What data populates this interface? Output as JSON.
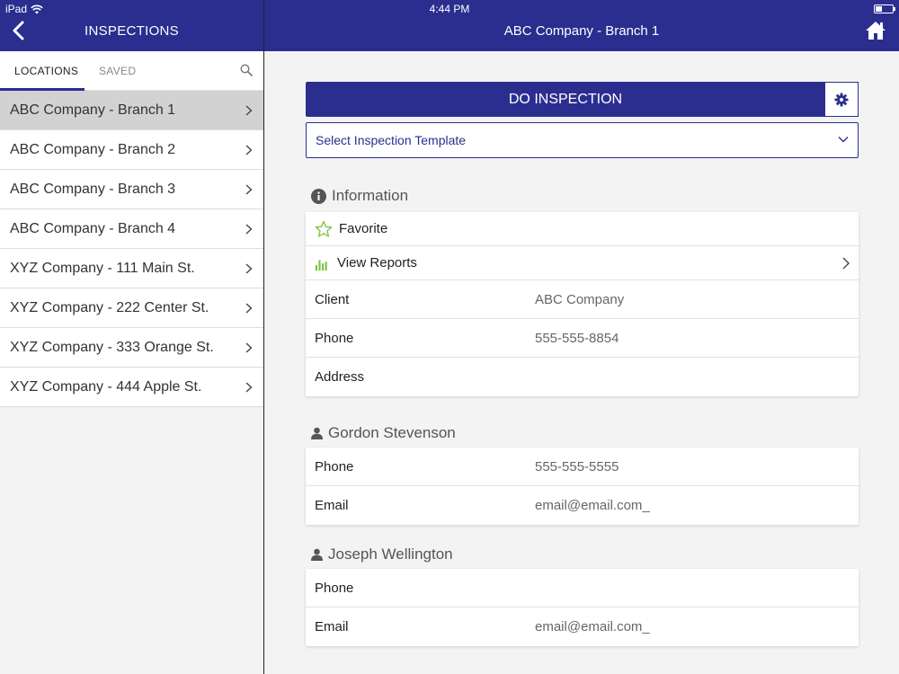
{
  "status": {
    "device": "iPad",
    "time": "4:44 PM",
    "battery_level": 0.4
  },
  "header": {
    "left_title": "INSPECTIONS",
    "right_title": "ABC Company - Branch 1"
  },
  "tabs": [
    {
      "label": "LOCATIONS"
    },
    {
      "label": "SAVED"
    }
  ],
  "locations": [
    {
      "label": "ABC Company - Branch 1"
    },
    {
      "label": "ABC Company - Branch 2"
    },
    {
      "label": "ABC Company - Branch 3"
    },
    {
      "label": "ABC Company - Branch 4"
    },
    {
      "label": "XYZ Company - 111 Main St."
    },
    {
      "label": "XYZ Company - 222 Center St."
    },
    {
      "label": "XYZ Company - 333 Orange St."
    },
    {
      "label": "XYZ Company - 444 Apple St."
    }
  ],
  "actions": {
    "do_inspection": "DO INSPECTION",
    "template_placeholder": "Select Inspection Template"
  },
  "information": {
    "title": "Information",
    "favorite": "Favorite",
    "view_reports": "View Reports",
    "rows": [
      {
        "label": "Client",
        "value": "ABC Company"
      },
      {
        "label": "Phone",
        "value": "555-555-8854"
      },
      {
        "label": "Address",
        "value": ""
      }
    ]
  },
  "contacts": [
    {
      "name": "Gordon Stevenson",
      "rows": [
        {
          "label": "Phone",
          "value": "555-555-5555"
        },
        {
          "label": "Email",
          "value": "email@email.com_"
        }
      ]
    },
    {
      "name": "Joseph Wellington",
      "rows": [
        {
          "label": "Phone",
          "value": ""
        },
        {
          "label": "Email",
          "value": "email@email.com_"
        }
      ]
    }
  ],
  "colors": {
    "brand": "#2b2e8f",
    "accent_green": "#7cc243",
    "selected_row": "#d2d2d2"
  }
}
